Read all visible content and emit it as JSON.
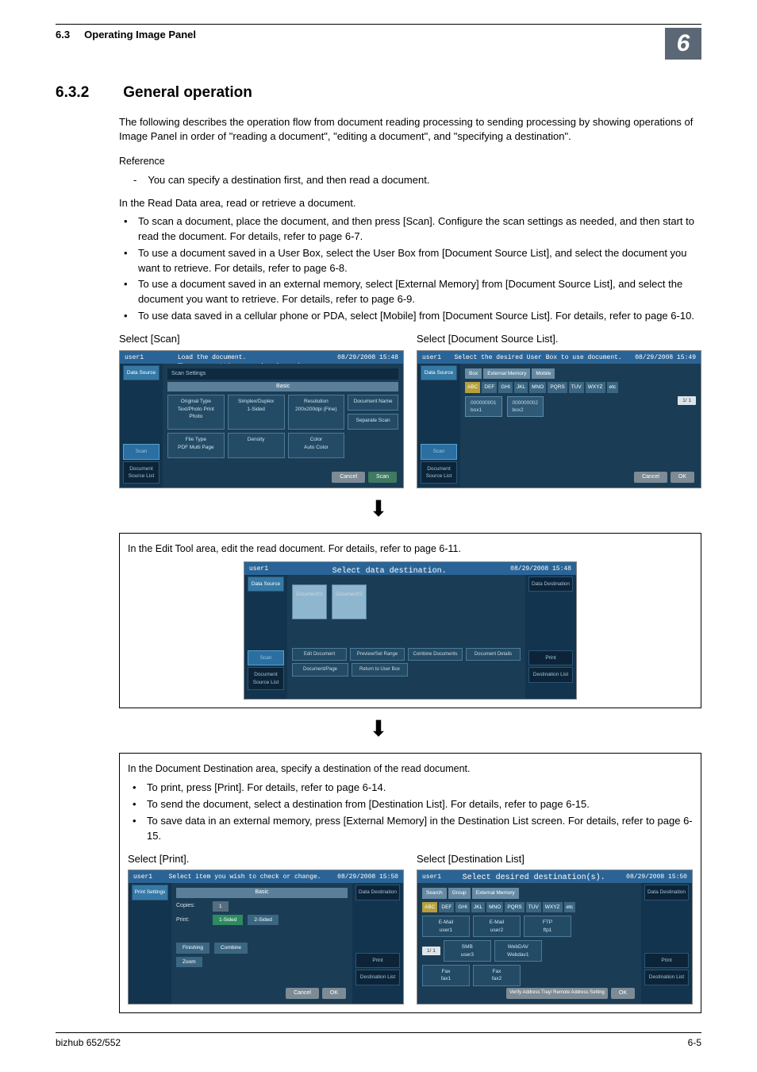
{
  "header": {
    "section_number": "6.3",
    "section_title": "Operating Image Panel",
    "chapter_number": "6"
  },
  "heading": {
    "number": "6.3.2",
    "title": "General operation"
  },
  "intro": "The following describes the operation flow from document reading processing to sending processing by showing operations of Image Panel in order of \"reading a document\", \"editing a document\", and \"specifying a destination\".",
  "reference_label": "Reference",
  "reference_item": "You can specify a destination first, and then read a document.",
  "read_lead": "In the Read Data area, read or retrieve a document.",
  "read_items": [
    "To scan a document, place the document, and then press [Scan]. Configure the scan settings as needed, and then start to read the document. For details, refer to page 6-7.",
    "To use a document saved in a User Box, select the User Box from [Document Source List], and select the document you want to retrieve. For details, refer to page 6-8.",
    "To use a document saved in an external memory, select [External Memory] from [Document Source List], and select the document you want to retrieve. For details, refer to page 6-9.",
    "To use data saved in a cellular phone or PDA, select [Mobile] from [Document Source List]. For details, refer to page 6-10."
  ],
  "captions": {
    "scan": "Select [Scan]",
    "doc_source": "Select [Document Source List].",
    "print": "Select [Print].",
    "dest_list": "Select [Destination List]"
  },
  "edit_box": "In the Edit Tool area, edit the read document. For details, refer to page 6-11.",
  "dest_lead": "In the Document Destination area, specify a destination of the read document.",
  "dest_items": [
    "To print, press [Print]. For details, refer to page 6-14.",
    "To send the document, select a destination from [Destination List]. For details, refer to page 6-15.",
    "To save data in an external memory, press [External Memory] in the Destination List screen. For details, refer to page 6-15."
  ],
  "screenshots": {
    "common": {
      "user": "user1",
      "timestamp": "08/29/2008 15:48",
      "timestamp2": "08/29/2008 15:49",
      "timestamp3": "08/29/2008 15:50"
    },
    "scan": {
      "banner1": "Load the document.",
      "banner2": "The scan settings can be changed.",
      "side_label": "Data Source",
      "side_scan": "Scan",
      "side_list": "Document Source List",
      "subhead": "Scan Settings",
      "basic": "Basic",
      "tiles_r1": [
        "Original Type",
        "Simplex/Duplex",
        "Resolution",
        "Document Name"
      ],
      "tiles_r1_sub": [
        "Text/Photo Print Photo",
        "1-Sided",
        "200x200dpi (Fine)",
        ""
      ],
      "tiles_r1_extra": "Separate Scan",
      "tiles_r2": [
        "File Type",
        "Density",
        "Color"
      ],
      "tiles_r2_sub": [
        "PDF Multi Page",
        "",
        "Auto Color"
      ],
      "btn_cancel": "Cancel",
      "btn_scan": "Scan"
    },
    "doc_source": {
      "banner": "Select the desired User Box to use document.",
      "tabs": [
        "Box",
        "External Memory",
        "Mobile"
      ],
      "alpha": [
        "ABC",
        "DEF",
        "GHI",
        "JKL",
        "MNO",
        "PQRS",
        "TUV",
        "WXYZ",
        "etc"
      ],
      "boxes": [
        {
          "id": "000000001",
          "name": "box1"
        },
        {
          "id": "000000002",
          "name": "box2"
        }
      ],
      "counter": "1/ 1",
      "btn_cancel": "Cancel",
      "btn_ok": "OK"
    },
    "edit": {
      "banner": "Select data destination.",
      "thumbs": [
        "Document01",
        "Document02"
      ],
      "right_items": [
        "Data Destination",
        "Print",
        "Destination List"
      ],
      "tools": [
        "Edit Document",
        "Preview/Set Range",
        "Combine Documents",
        "Document Details",
        "Document/Page",
        "Return to User Box"
      ]
    },
    "print": {
      "banner": "Select item you wish to check or change.",
      "left_tab": "Print Settings",
      "basic": "Basic",
      "copies_lbl": "Copies:",
      "copies_val": "1",
      "print_lbl": "Print:",
      "sided1": "1-Sided",
      "sided2": "2-Sided",
      "finishing": "Finishing",
      "combine": "Combine",
      "zoom": "Zoom",
      "btn_cancel": "Cancel",
      "btn_ok": "OK",
      "right_items": [
        "Data Destination",
        "Print",
        "Destination List"
      ]
    },
    "dest": {
      "banner": "Select desired destination(s).",
      "tabs": [
        "Search",
        "Group",
        "External Memory"
      ],
      "alpha": [
        "ABC",
        "DEF",
        "GHI",
        "JKL",
        "MNO",
        "PQRS",
        "TUV",
        "WXYZ",
        "etc"
      ],
      "entries": [
        {
          "type": "E-Mail",
          "name": "user1"
        },
        {
          "type": "E-Mail",
          "name": "user2"
        },
        {
          "type": "FTP",
          "name": "ftp1"
        },
        {
          "type": "SMB",
          "name": "user3"
        },
        {
          "type": "WebDAV",
          "name": "Webdav1"
        },
        {
          "type": "Fax",
          "name": "fax1"
        },
        {
          "type": "Fax",
          "name": "fax2"
        }
      ],
      "counter": "1/ 1",
      "verify": "Verify Address Tray/ Remote Address Setting",
      "btn_ok": "OK",
      "right_items": [
        "Data Destination",
        "Print",
        "Destination List"
      ]
    }
  },
  "footer": {
    "left": "bizhub 652/552",
    "right": "6-5"
  }
}
